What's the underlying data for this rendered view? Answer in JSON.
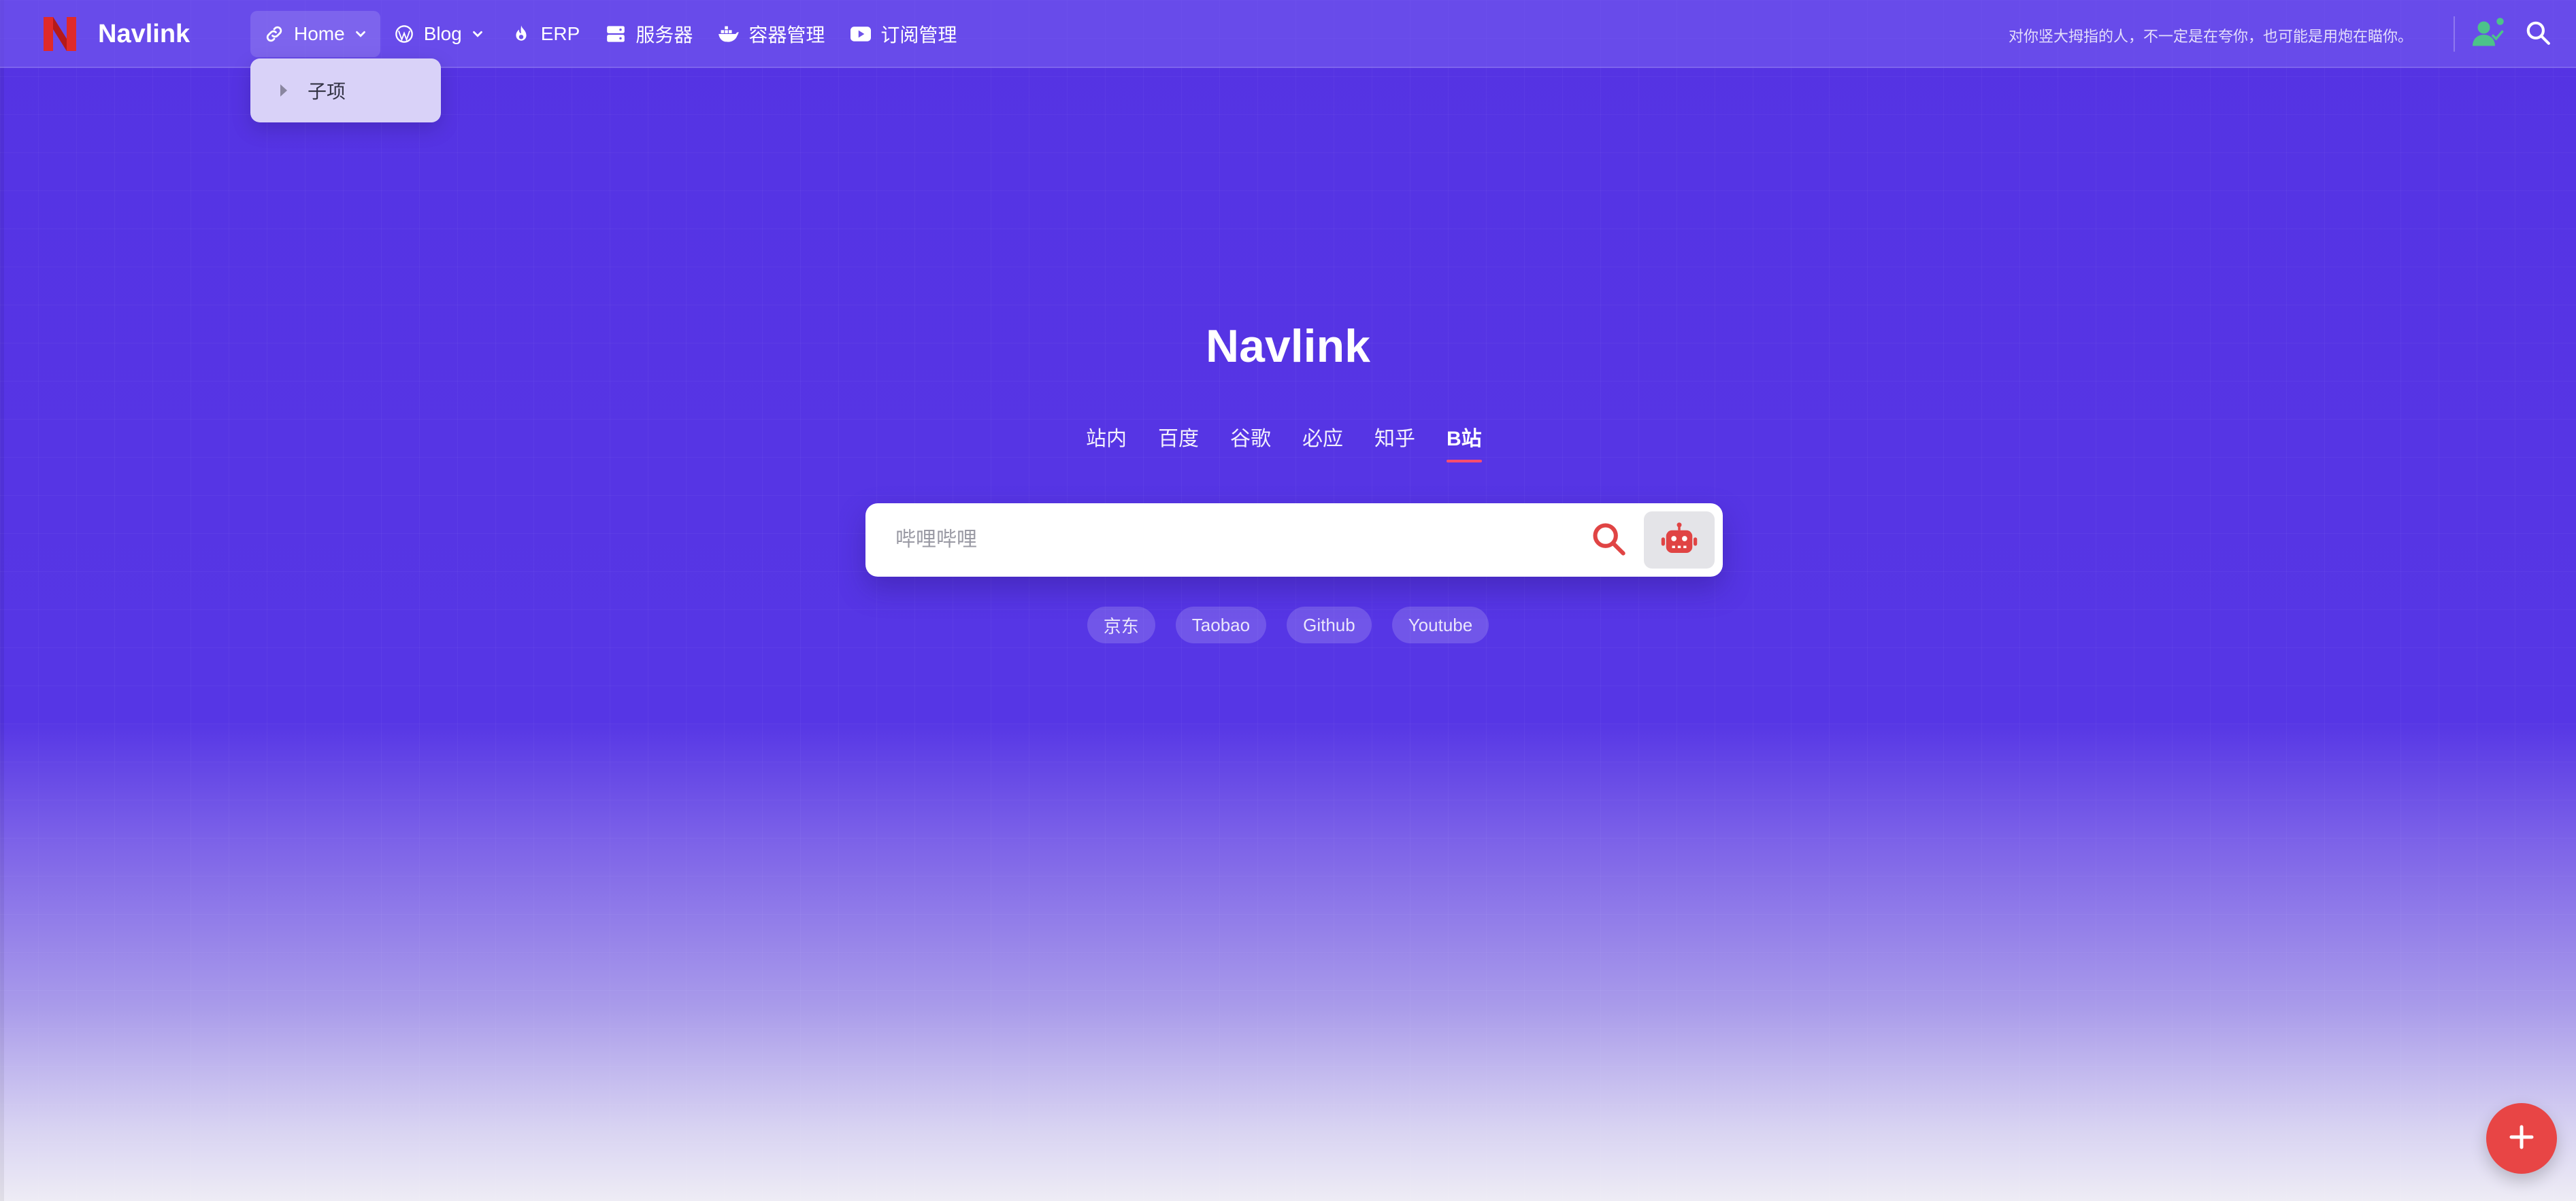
{
  "brand": {
    "name": "Navlink",
    "logo_icon": "n-logo-icon",
    "logo_color": "#e02a2a"
  },
  "menu": [
    {
      "label": "Home",
      "icon": "link-icon",
      "has_children": true
    },
    {
      "label": "Blog",
      "icon": "wordpress-icon",
      "has_children": true
    },
    {
      "label": "ERP",
      "icon": "fire-icon",
      "has_children": false
    },
    {
      "label": "服务器",
      "icon": "server-icon",
      "has_children": false
    },
    {
      "label": "容器管理",
      "icon": "docker-icon",
      "has_children": false
    },
    {
      "label": "订阅管理",
      "icon": "youtube-icon",
      "has_children": false
    }
  ],
  "dropdown": {
    "items": [
      {
        "label": "子项"
      }
    ]
  },
  "header": {
    "motto": "对你竖大拇指的人，不一定是在夸你，也可能是用炮在瞄你。",
    "user_icon": "user-check-icon",
    "search_icon": "search-icon"
  },
  "hero": {
    "title": "Navlink"
  },
  "search": {
    "tabs": [
      {
        "label": "站内",
        "active": false
      },
      {
        "label": "百度",
        "active": false
      },
      {
        "label": "谷歌",
        "active": false
      },
      {
        "label": "必应",
        "active": false
      },
      {
        "label": "知乎",
        "active": false
      },
      {
        "label": "B站",
        "active": true
      }
    ],
    "placeholder": "哔哩哔哩",
    "submit_icon": "search-icon",
    "ai_icon": "robot-icon"
  },
  "quick_links": [
    {
      "label": "京东"
    },
    {
      "label": "Taobao"
    },
    {
      "label": "Github"
    },
    {
      "label": "Youtube"
    }
  ],
  "fab": {
    "icon": "plus-icon",
    "color": "#e84545"
  },
  "colors": {
    "accent": "#5533e3",
    "active_underline": "#ff4d6d",
    "search_icon": "#e04444"
  }
}
